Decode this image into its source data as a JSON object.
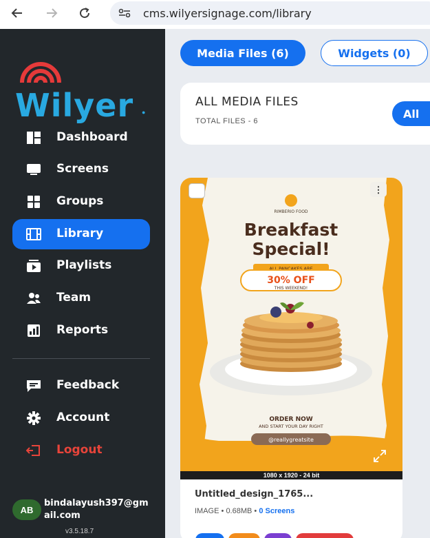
{
  "browser": {
    "url": "cms.wilyersignage.com/library",
    "icons": [
      "back-arrow-icon",
      "forward-arrow-icon",
      "reload-icon",
      "site-info-icon"
    ]
  },
  "sidebar": {
    "logo_text": "Wilyer",
    "items": [
      {
        "label": "Dashboard",
        "icon": "dashboard-icon"
      },
      {
        "label": "Screens",
        "icon": "monitor-icon"
      },
      {
        "label": "Groups",
        "icon": "grid-icon"
      },
      {
        "label": "Library",
        "icon": "film-icon"
      },
      {
        "label": "Playlists",
        "icon": "playlist-icon"
      },
      {
        "label": "Team",
        "icon": "team-icon"
      },
      {
        "label": "Reports",
        "icon": "report-icon"
      }
    ],
    "bottom_items": [
      {
        "label": "Feedback",
        "icon": "feedback-icon"
      },
      {
        "label": "Account",
        "icon": "gear-icon"
      },
      {
        "label": "Logout",
        "icon": "logout-icon"
      }
    ],
    "active_item": "Library",
    "user": {
      "initials": "AB",
      "email": "bindalayush397@gmail.com",
      "version": "v3.5.18.7"
    }
  },
  "tabs": {
    "media": "Media Files (6)",
    "widgets": "Widgets (0)"
  },
  "header": {
    "title": "ALL MEDIA FILES",
    "subtitle": "TOTAL FILES - 6",
    "filter_button": "All"
  },
  "media_card": {
    "dimensions": "1080 x 1920 - 24 bit",
    "filename": "Untitled_design_1765...",
    "type": "IMAGE",
    "size": "0.68MB",
    "screens": "0 Screens",
    "poster": {
      "brand": "RIMBERIO FOOD",
      "headline_1": "Breakfast",
      "headline_2": "Special!",
      "pancakes_label": "ALL PANCAKES ARE",
      "offer": "30% OFF",
      "offer_sub": "THIS WEEKEND!",
      "order_now": "ORDER NOW",
      "order_sub": "AND START YOUR DAY RIGHT",
      "site": "@reallygreatsite"
    }
  },
  "colors": {
    "accent": "#1570ef",
    "sidebar_bg": "#22272b",
    "logout": "#e8443a",
    "poster_orange": "#f2a41c"
  }
}
